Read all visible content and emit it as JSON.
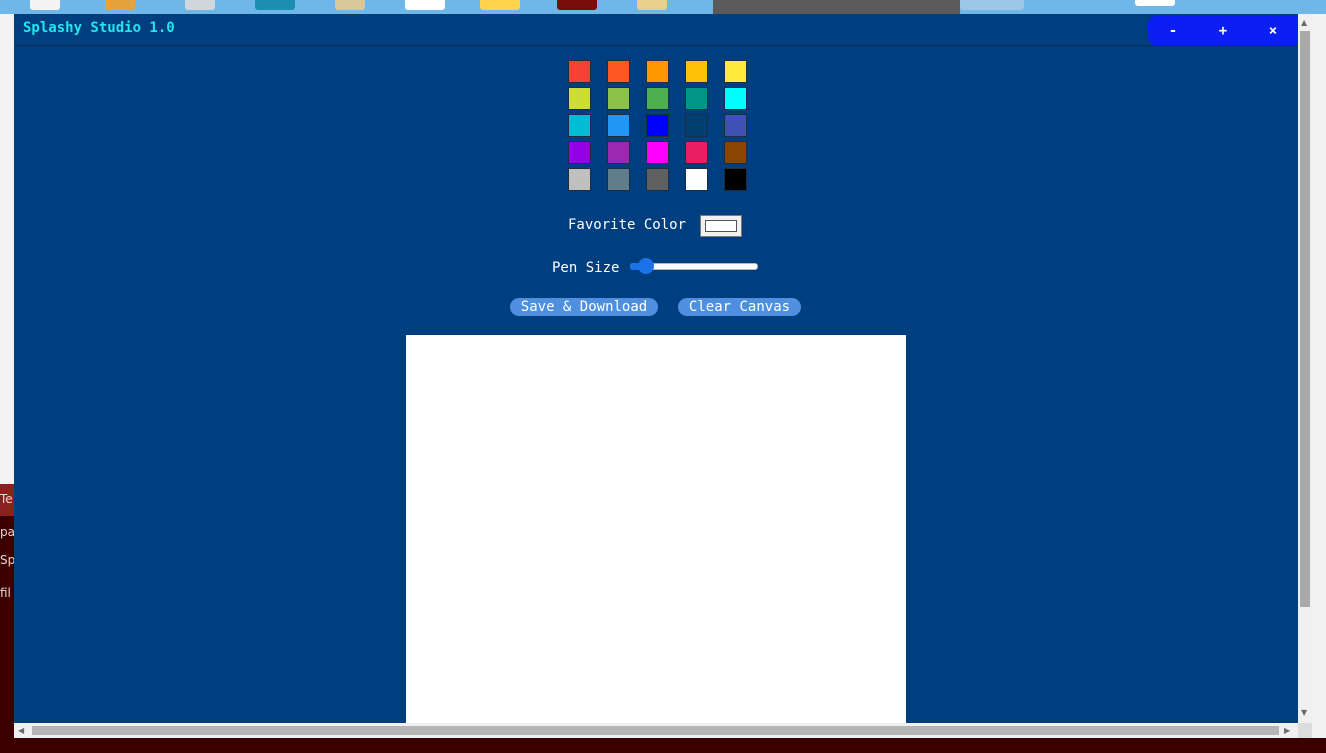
{
  "window": {
    "title": "Splashy Studio 1.0",
    "controls": {
      "minimize": "-",
      "maximize": "+",
      "close": "×"
    }
  },
  "palette": {
    "colors": [
      "#f44336",
      "#ff5722",
      "#ff9800",
      "#ffc107",
      "#ffeb3b",
      "#cddc39",
      "#8bc34a",
      "#4caf50",
      "#009688",
      "#00ffff",
      "#00bcd4",
      "#2196f3",
      "#0000ff",
      "#003f6f",
      "#3f51b5",
      "#9400e8",
      "#9c27b0",
      "#ff00ff",
      "#e91e63",
      "#8b4500",
      "#c0c0c0",
      "#607d8b",
      "#606060",
      "#ffffff",
      "#000000"
    ]
  },
  "favorite": {
    "label": "Favorite Color",
    "value": "#ffffff"
  },
  "pen": {
    "label": "Pen Size",
    "value": 1
  },
  "buttons": {
    "save": "Save & Download",
    "clear": "Clear Canvas"
  },
  "desktop": {
    "side_snippets": [
      "Te",
      "pac",
      "Sp",
      "fil"
    ]
  }
}
